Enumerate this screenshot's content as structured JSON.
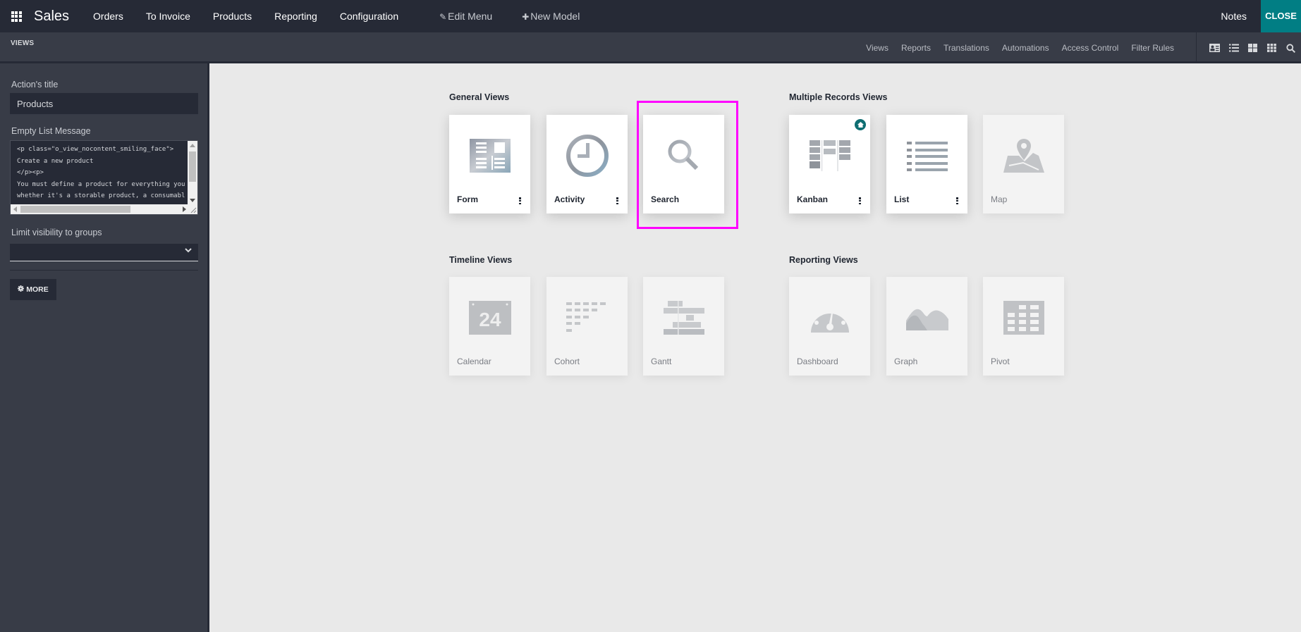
{
  "topbar": {
    "app_name": "Sales",
    "menu": [
      "Orders",
      "To Invoice",
      "Products",
      "Reporting",
      "Configuration"
    ],
    "edit_menu": "Edit Menu",
    "new_model": "New Model",
    "notes": "Notes",
    "close": "CLOSE"
  },
  "subbar": {
    "section": "VIEWS",
    "nav": [
      "Views",
      "Reports",
      "Translations",
      "Automations",
      "Access Control",
      "Filter Rules"
    ],
    "view_switch_icons": [
      "form-view-icon",
      "list-view-icon",
      "kanban-view-icon",
      "grid-view-icon",
      "search-icon"
    ]
  },
  "sidebar": {
    "action_title_label": "Action's title",
    "action_title_value": "Products",
    "empty_message_label": "Empty List Message",
    "empty_message_value": "<p class=\"o_view_nocontent_smiling_face\">\nCreate a new product\n</p><p>\nYou must define a product for everything you\nwhether it's a storable product, a consumabl",
    "groups_label": "Limit visibility to groups",
    "groups_value": "",
    "more_button": "MORE"
  },
  "sections": {
    "general": {
      "title": "General Views",
      "cards": [
        {
          "label": "Form",
          "enabled": true,
          "menu": true
        },
        {
          "label": "Activity",
          "enabled": true,
          "menu": true
        },
        {
          "label": "Search",
          "enabled": true,
          "menu": false,
          "highlighted": true
        }
      ]
    },
    "multiple": {
      "title": "Multiple Records Views",
      "cards": [
        {
          "label": "Kanban",
          "enabled": true,
          "menu": true,
          "default": true
        },
        {
          "label": "List",
          "enabled": true,
          "menu": true
        },
        {
          "label": "Map",
          "enabled": false
        }
      ]
    },
    "timeline": {
      "title": "Timeline Views",
      "cards": [
        {
          "label": "Calendar",
          "enabled": false,
          "calendar_day": "24"
        },
        {
          "label": "Cohort",
          "enabled": false
        },
        {
          "label": "Gantt",
          "enabled": false
        }
      ]
    },
    "reporting": {
      "title": "Reporting Views",
      "cards": [
        {
          "label": "Dashboard",
          "enabled": false
        },
        {
          "label": "Graph",
          "enabled": false
        },
        {
          "label": "Pivot",
          "enabled": false
        }
      ]
    }
  },
  "colors": {
    "topbar_bg": "#262a36",
    "subbar_bg": "#383c47",
    "accent_teal": "#017e84",
    "highlight": "#ff00ff"
  }
}
